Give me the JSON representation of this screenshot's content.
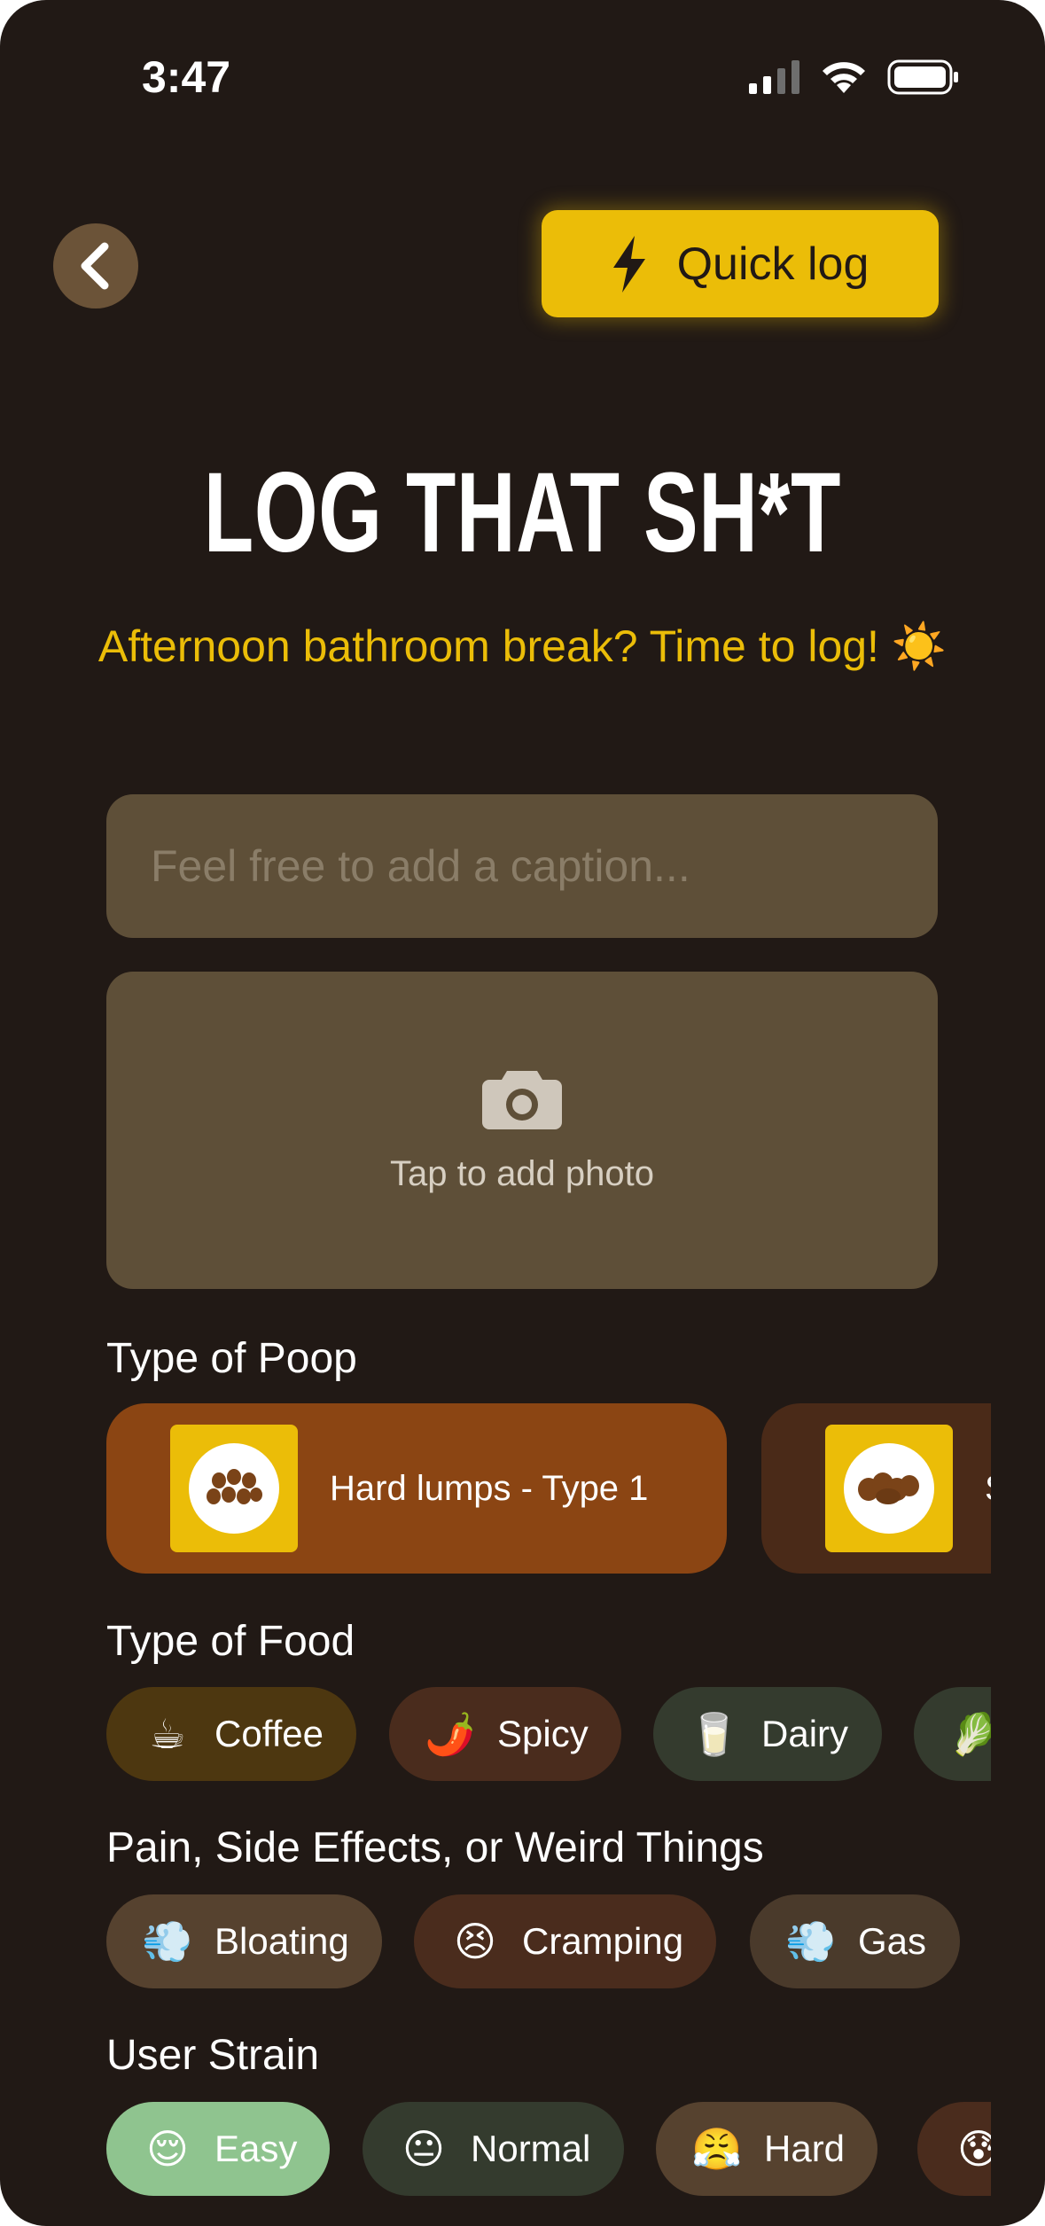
{
  "status_bar": {
    "time": "3:47"
  },
  "header": {
    "quick_log_label": "Quick log"
  },
  "title": "LOG THAT SH*T",
  "subtitle": "Afternoon bathroom break? Time to log! ☀️",
  "caption": {
    "placeholder": "Feel free to add a caption...",
    "value": ""
  },
  "photo": {
    "label": "Tap to add photo"
  },
  "poop_section": {
    "title": "Type of Poop",
    "items": [
      {
        "label": "Hard lumps - Type 1",
        "selected": true
      },
      {
        "label": "S",
        "selected": false
      }
    ]
  },
  "food_section": {
    "title": "Type of Food",
    "items": [
      {
        "emoji": "☕",
        "label": "Coffee"
      },
      {
        "emoji": "🌶️",
        "label": "Spicy"
      },
      {
        "emoji": "🥛",
        "label": "Dairy"
      },
      {
        "emoji": "🥬",
        "label": ""
      }
    ]
  },
  "effects_section": {
    "title": "Pain, Side Effects, or Weird Things",
    "items": [
      {
        "emoji": "💨",
        "label": "Bloating"
      },
      {
        "emoji": "😣",
        "label": "Cramping"
      },
      {
        "emoji": "💨",
        "label": "Gas"
      }
    ]
  },
  "strain_section": {
    "title": "User Strain",
    "items": [
      {
        "emoji": "😌",
        "label": "Easy",
        "selected": true
      },
      {
        "emoji": "😐",
        "label": "Normal",
        "selected": false
      },
      {
        "emoji": "😤",
        "label": "Hard",
        "selected": false
      },
      {
        "emoji": "😰",
        "label": "",
        "selected": false
      }
    ]
  },
  "colors": {
    "background": "#211915",
    "accent": "#ebbd08",
    "card": "#5e4f38",
    "poop_selected": "#8b4513",
    "strain_selected": "#8fc48f"
  }
}
